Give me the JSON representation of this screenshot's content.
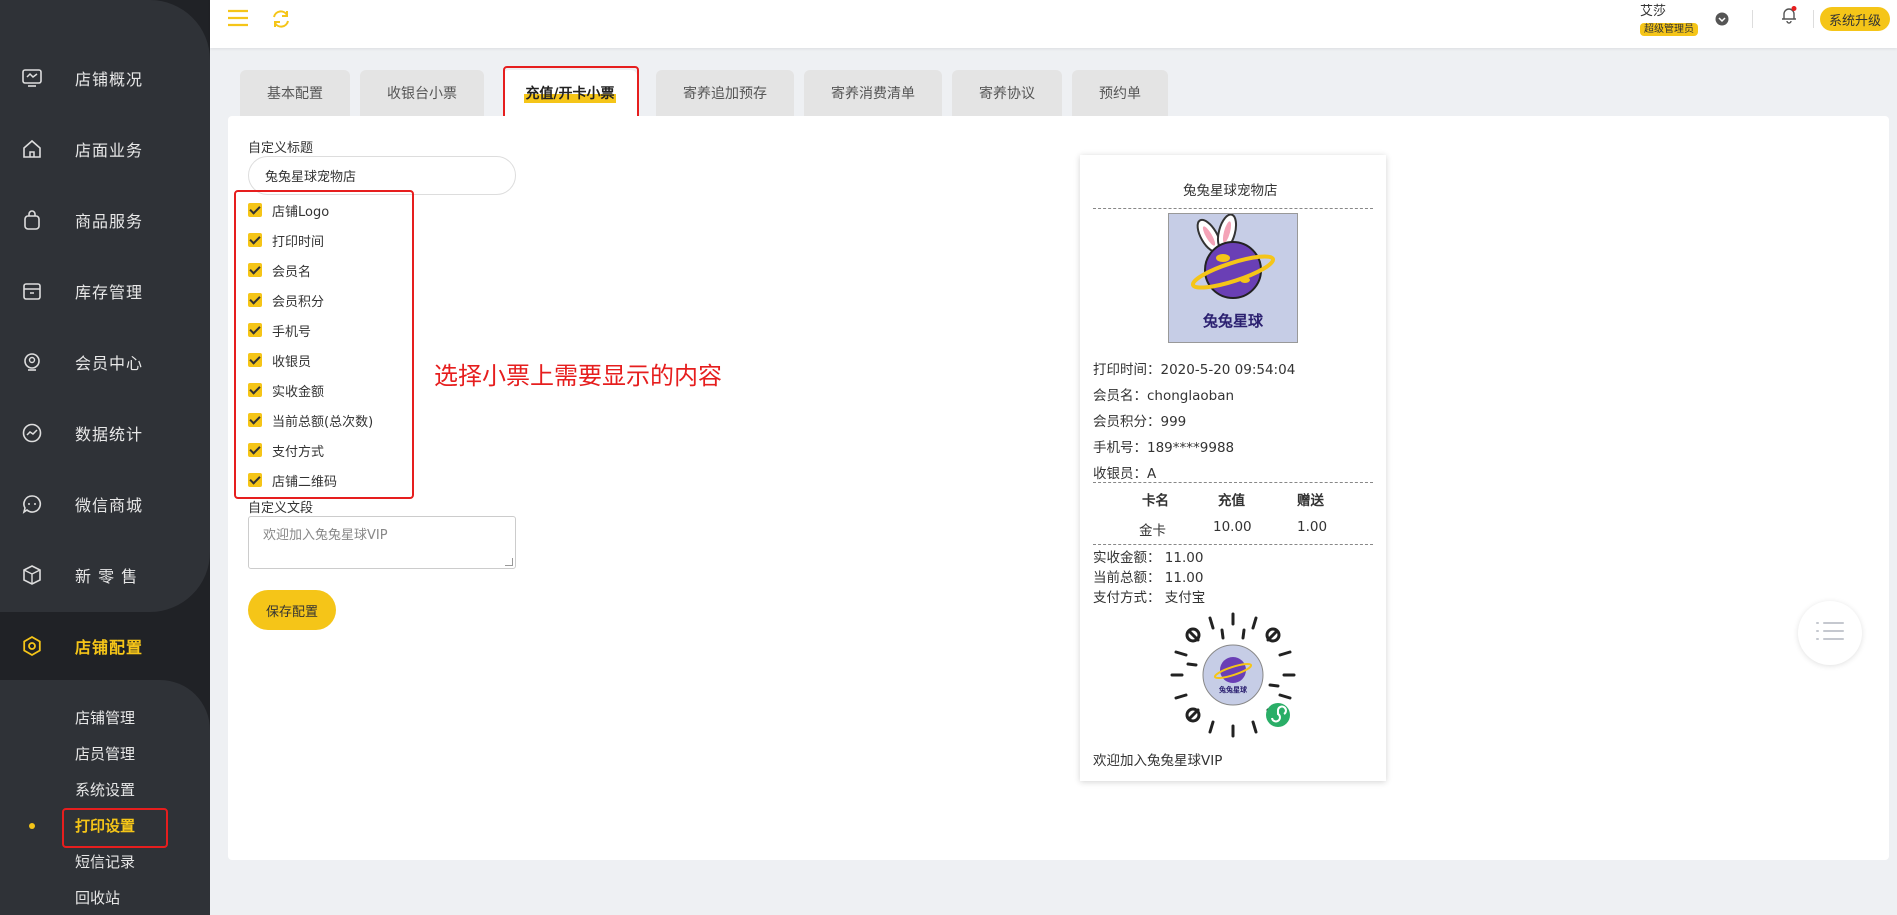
{
  "sidebar": {
    "items": [
      {
        "label": "店铺概况",
        "icon": "monitor-icon"
      },
      {
        "label": "店面业务",
        "icon": "home-icon"
      },
      {
        "label": "商品服务",
        "icon": "bag-icon"
      },
      {
        "label": "库存管理",
        "icon": "box-icon"
      },
      {
        "label": "会员中心",
        "icon": "member-icon"
      },
      {
        "label": "数据统计",
        "icon": "chart-icon"
      },
      {
        "label": "微信商城",
        "icon": "chat-icon"
      },
      {
        "label": "新 零 售",
        "icon": "cube-icon"
      },
      {
        "label": "店铺配置",
        "icon": "settings-icon",
        "active": true
      }
    ],
    "sub_items": [
      {
        "label": "店铺管理"
      },
      {
        "label": "店员管理"
      },
      {
        "label": "系统设置"
      },
      {
        "label": "打印设置",
        "active": true
      },
      {
        "label": "短信记录"
      },
      {
        "label": "回收站"
      }
    ]
  },
  "topbar": {
    "user_name": "艾莎",
    "user_role": "超级管理员",
    "upgrade_label": "系统升级"
  },
  "tabs": [
    {
      "label": "基本配置"
    },
    {
      "label": "收银台小票"
    },
    {
      "label": "充值/开卡小票",
      "active": true
    },
    {
      "label": "寄养追加预存"
    },
    {
      "label": "寄养消费清单"
    },
    {
      "label": "寄养协议"
    },
    {
      "label": "预约单"
    }
  ],
  "form": {
    "title_label": "自定义标题",
    "title_value": "兔兔星球宠物店",
    "checkboxes": [
      {
        "label": "店铺Logo",
        "checked": true
      },
      {
        "label": "打印时间",
        "checked": true
      },
      {
        "label": "会员名",
        "checked": true
      },
      {
        "label": "会员积分",
        "checked": true
      },
      {
        "label": "手机号",
        "checked": true
      },
      {
        "label": "收银员",
        "checked": true
      },
      {
        "label": "实收金额",
        "checked": true
      },
      {
        "label": "当前总额(总次数)",
        "checked": true
      },
      {
        "label": "支付方式",
        "checked": true
      },
      {
        "label": "店铺二维码",
        "checked": true
      }
    ],
    "custom_text_label": "自定义文段",
    "custom_text_value": "欢迎加入兔兔星球VIP",
    "save_label": "保存配置"
  },
  "annotation": "选择小票上需要显示的内容",
  "receipt": {
    "shop_name": "兔兔星球宠物店",
    "logo_text": "兔兔星球",
    "print_time": "打印时间：2020-5-20 09:54:04",
    "member_name": "会员名：chonglaoban",
    "member_points": "会员积分：999",
    "phone": "手机号：189****9988",
    "cashier": "收银员：A",
    "table_headers": [
      "卡名",
      "充值",
      "赠送"
    ],
    "table_row": [
      "金卡",
      "10.00",
      "1.00"
    ],
    "received": "实收金额：  11.00",
    "current_total": "当前总额：  11.00",
    "payment": "支付方式：  支付宝",
    "qr_text": "兔兔星球",
    "footer": "欢迎加入兔兔星球VIP"
  },
  "colors": {
    "accent": "#f5c518",
    "sidebar_bg": "#2f3237",
    "highlight_red": "#e61e1e"
  }
}
